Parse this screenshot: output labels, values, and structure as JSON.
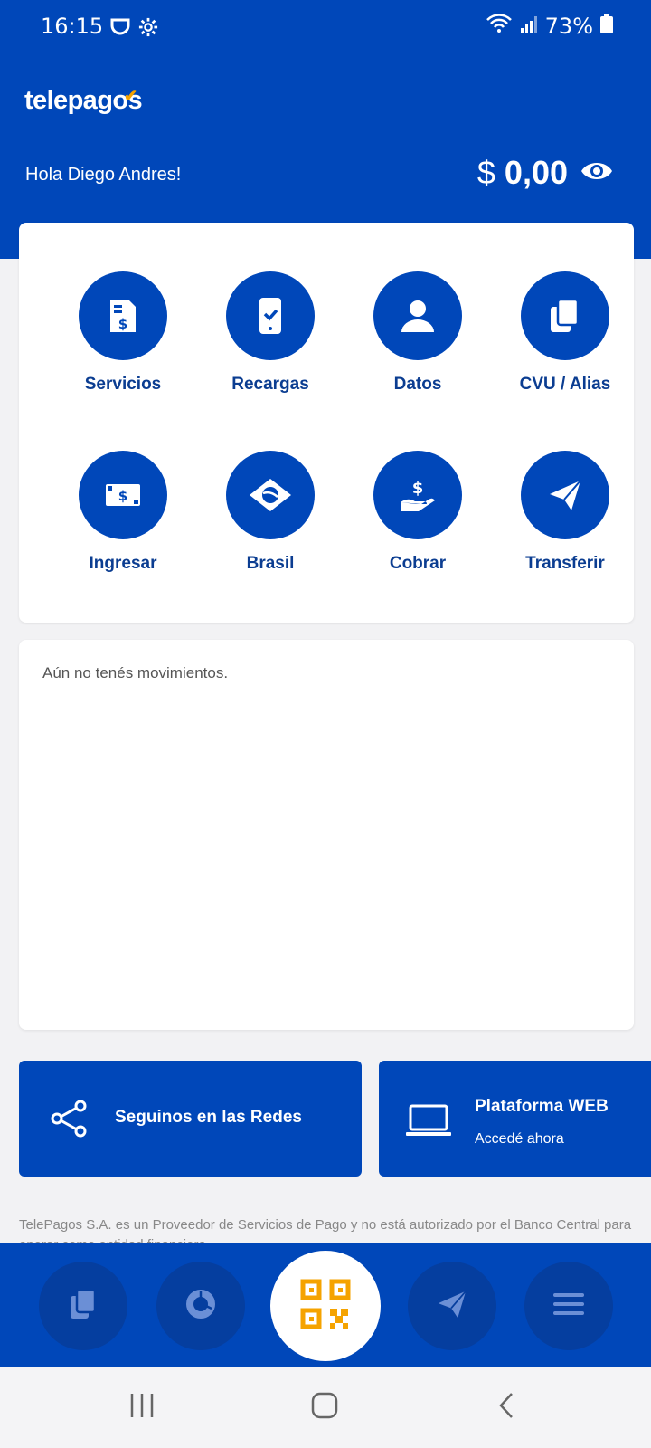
{
  "status_bar": {
    "time": "16:15",
    "battery": "73%",
    "icons": [
      "pin-icon",
      "gear-icon",
      "wifi-icon",
      "signal-icon",
      "battery-icon"
    ]
  },
  "app": {
    "logo_text": "telepagos",
    "greeting": "Hola Diego Andres!",
    "currency_symbol": "$",
    "balance": "0,00"
  },
  "actions": [
    {
      "label": "Servicios",
      "icon": "invoice-dollar-icon"
    },
    {
      "label": "Recargas",
      "icon": "phone-check-icon"
    },
    {
      "label": "Datos",
      "icon": "user-icon"
    },
    {
      "label": "CVU / Alias",
      "icon": "copy-icon"
    },
    {
      "label": "Ingresar",
      "icon": "banknote-icon"
    },
    {
      "label": "Brasil",
      "icon": "brazil-flag-icon"
    },
    {
      "label": "Cobrar",
      "icon": "hand-dollar-icon"
    },
    {
      "label": "Transferir",
      "icon": "paper-plane-icon"
    }
  ],
  "movements": {
    "empty_text": "Aún no tenés movimientos."
  },
  "promos": {
    "social": {
      "title": "Seguinos en las Redes",
      "icon": "share-icon"
    },
    "web": {
      "title": "Plataforma WEB",
      "subtitle": "Accedé ahora",
      "icon": "laptop-icon"
    }
  },
  "disclaimer": "TelePagos S.A. es un Proveedor de Servicios de Pago y no está autorizado por el Banco Central para operar como entidad financiera.",
  "bottom_nav": [
    "copy-icon",
    "donut-chart-icon",
    "qr-code-icon",
    "paper-plane-icon",
    "menu-icon"
  ],
  "colors": {
    "brand_blue": "#0047b9",
    "accent_orange": "#f5a300",
    "label_blue": "#0b3d91"
  }
}
